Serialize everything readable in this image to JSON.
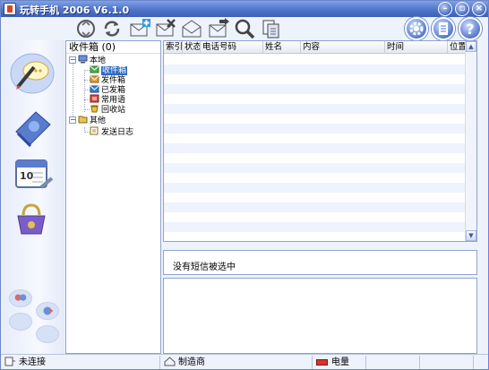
{
  "window": {
    "title": "玩转手机 2006 V6.1.0",
    "controls": [
      "minimize",
      "maximize",
      "close"
    ]
  },
  "toolbar": {
    "buttons": [
      {
        "name": "connect-icon"
      },
      {
        "name": "sync-icon"
      },
      {
        "name": "new-message-icon"
      },
      {
        "name": "delete-message-icon"
      },
      {
        "name": "reply-icon"
      },
      {
        "name": "forward-icon"
      },
      {
        "name": "search-icon"
      },
      {
        "name": "copy-icon"
      }
    ],
    "round_buttons": [
      {
        "name": "settings-icon"
      },
      {
        "name": "notes-icon"
      },
      {
        "name": "help-icon"
      }
    ]
  },
  "sidebar": {
    "items": [
      {
        "name": "sms-icon",
        "active": true
      },
      {
        "name": "phonebook-icon"
      },
      {
        "name": "calendar-icon"
      },
      {
        "name": "media-icon"
      }
    ]
  },
  "tree": {
    "header_label": "收件箱",
    "header_count": "(0)",
    "local_label": "本地",
    "local_items": [
      {
        "label": "收件箱",
        "selected": true,
        "icon": "inbox-icon"
      },
      {
        "label": "发件箱",
        "icon": "outbox-icon"
      },
      {
        "label": "已发箱",
        "icon": "sent-icon"
      },
      {
        "label": "常用语",
        "icon": "phrases-icon"
      },
      {
        "label": "回收站",
        "icon": "recycle-bin-icon"
      }
    ],
    "other_label": "其他",
    "other_items": [
      {
        "label": "发送日志",
        "icon": "send-log-icon"
      }
    ]
  },
  "list": {
    "columns": [
      "索引",
      "状态",
      "电话号码",
      "姓名",
      "内容",
      "时间",
      "位置"
    ],
    "rows": []
  },
  "detail": {
    "subject_text": "没有短信被选中"
  },
  "status": {
    "connection": "未连接",
    "manufacturer": "制造商",
    "battery": "电量"
  },
  "colors": {
    "accent": "#4f74c8",
    "selection": "#316ac5",
    "row_stripe": "#eef3fd"
  }
}
